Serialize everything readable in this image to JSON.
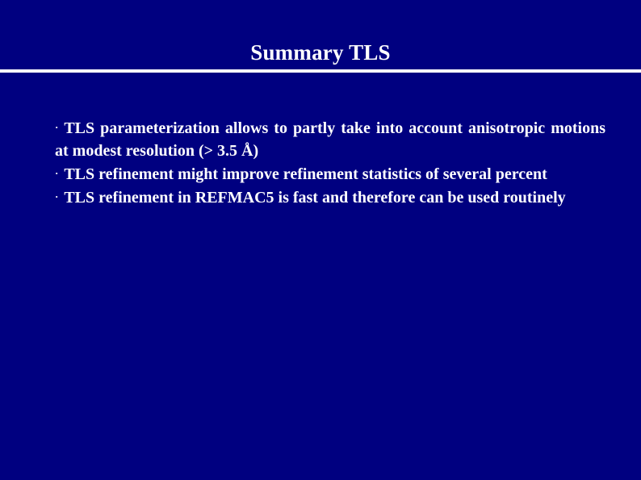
{
  "slide": {
    "title": "Summary TLS",
    "background_color": "#000080",
    "text_color": "#FFFFFF",
    "rule_color": "#FFFFFF",
    "bullet_glyph": "·",
    "bullets": [
      {
        "marker": "·",
        "text": "TLS parameterization allows to partly take into account anisotropic motions at modest resolution (> 3.5 Å)"
      },
      {
        "marker": "·",
        "text": "TLS refinement might improve refinement statistics of several percent"
      },
      {
        "marker": "·",
        "text": "TLS refinement in REFMAC5 is fast and therefore can be used routinely"
      }
    ]
  }
}
